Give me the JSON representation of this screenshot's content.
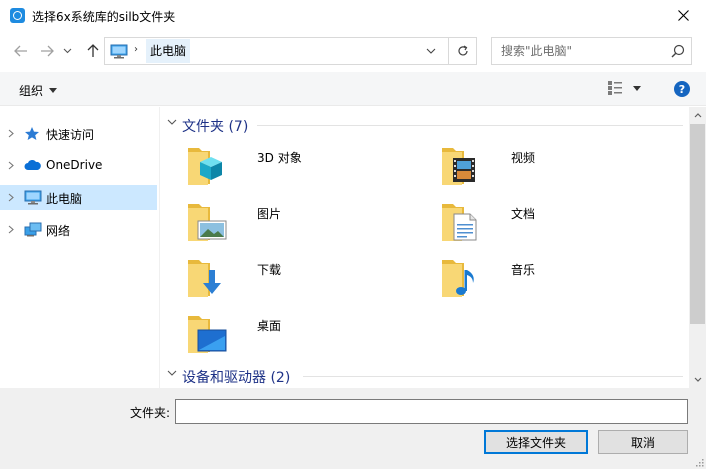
{
  "window": {
    "title": "选择6x系统库的silb文件夹",
    "accent": "#1e8be0"
  },
  "address": {
    "crumb": "此电脑",
    "search_placeholder": "搜索\"此电脑\""
  },
  "toolbar": {
    "organize_label": "组织",
    "help_label": "?"
  },
  "nav": {
    "items": [
      {
        "label": "快速访问",
        "icon": "star-icon"
      },
      {
        "label": "OneDrive",
        "icon": "cloud-icon"
      },
      {
        "label": "此电脑",
        "icon": "computer-icon"
      },
      {
        "label": "网络",
        "icon": "network-icon"
      }
    ]
  },
  "content": {
    "groups": [
      {
        "label": "文件夹 (7)"
      },
      {
        "label": "设备和驱动器 (2)"
      }
    ],
    "folders": [
      {
        "label": "3D 对象",
        "icon": "3d-objects-folder-icon"
      },
      {
        "label": "视频",
        "icon": "videos-folder-icon"
      },
      {
        "label": "图片",
        "icon": "pictures-folder-icon"
      },
      {
        "label": "文档",
        "icon": "documents-folder-icon"
      },
      {
        "label": "下载",
        "icon": "downloads-folder-icon"
      },
      {
        "label": "音乐",
        "icon": "music-folder-icon"
      },
      {
        "label": "桌面",
        "icon": "desktop-folder-icon"
      }
    ]
  },
  "footer": {
    "folder_label": "文件夹:",
    "folder_value": "",
    "select_button": "选择文件夹",
    "cancel_button": "取消"
  }
}
